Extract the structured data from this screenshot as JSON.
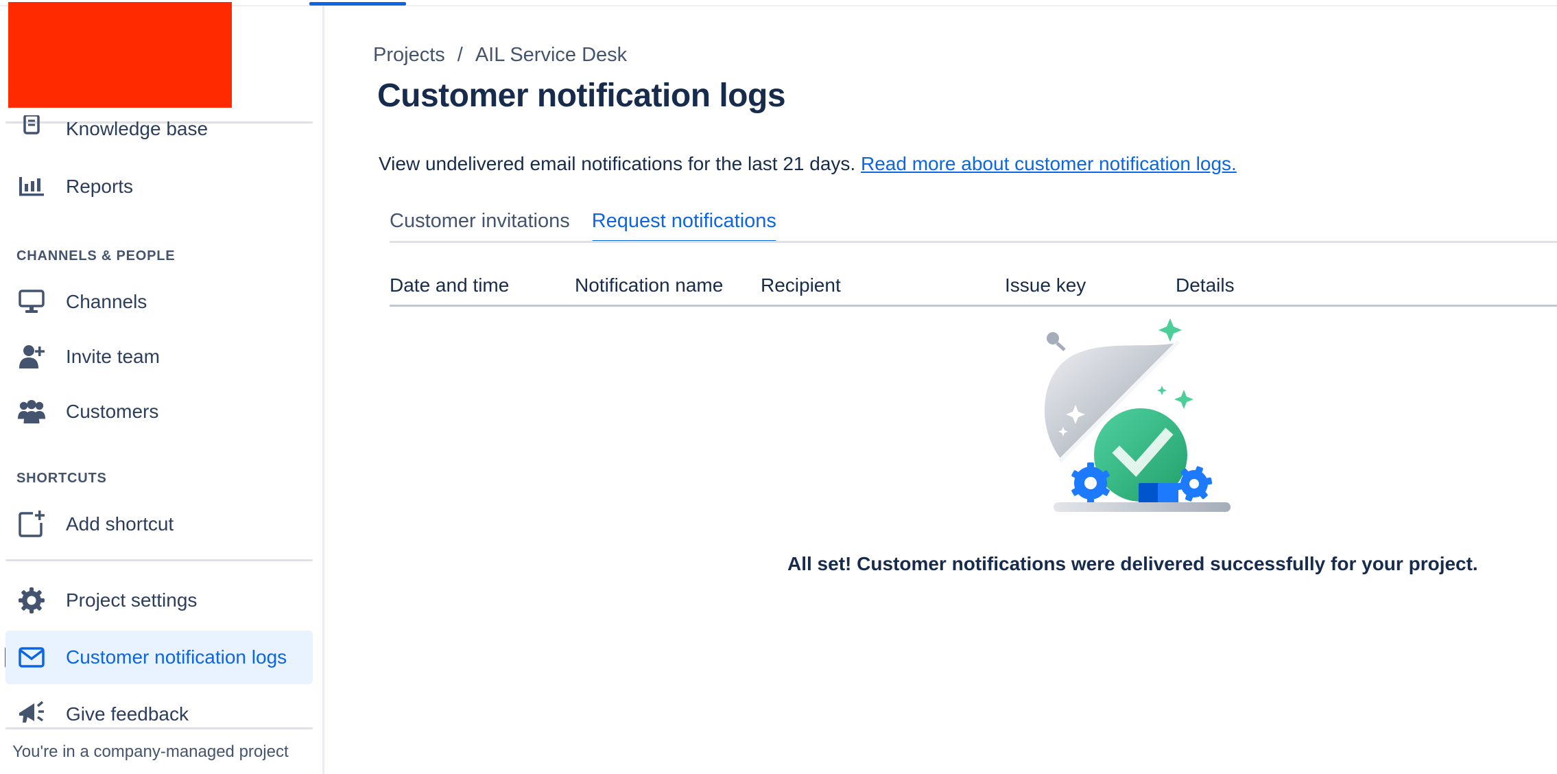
{
  "sidebar": {
    "items": {
      "knowledge_base": "Knowledge base",
      "reports": "Reports",
      "channels": "Channels",
      "invite_team": "Invite team",
      "customers": "Customers",
      "add_shortcut": "Add shortcut",
      "project_settings": "Project settings",
      "customer_notification_logs": "Customer notification logs",
      "give_feedback": "Give feedback"
    },
    "sections": {
      "channels_people": "CHANNELS & PEOPLE",
      "shortcuts": "SHORTCUTS"
    },
    "footer": "You're in a company-managed project"
  },
  "breadcrumb": {
    "projects": "Projects",
    "separator": "/",
    "project": "AIL Service Desk"
  },
  "page": {
    "title": "Customer notification logs",
    "description": "View undelivered email notifications for the last 21 days.",
    "link": "Read more about customer notification logs."
  },
  "tabs": {
    "customer_invitations": "Customer invitations",
    "request_notifications": "Request notifications",
    "selected": "Request notifications"
  },
  "table": {
    "columns": [
      "Date and time",
      "Notification name",
      "Recipient",
      "Issue key",
      "Details"
    ]
  },
  "empty_state": {
    "message": "All set! Customer notifications were delivered successfully for your project."
  },
  "colors": {
    "accent": "#0c66e4",
    "text": "#172b4d",
    "subtle_text": "#44546f",
    "logo_placeholder": "#ff2a00",
    "success_green": "#36b37e"
  },
  "icons": {
    "knowledge_base": "book-icon",
    "reports": "bar-chart-icon",
    "channels": "monitor-icon",
    "invite_team": "person-add-icon",
    "customers": "people-group-icon",
    "add_shortcut": "add-page-icon",
    "project_settings": "gear-icon",
    "customer_notification_logs": "email-icon",
    "give_feedback": "megaphone-icon"
  }
}
